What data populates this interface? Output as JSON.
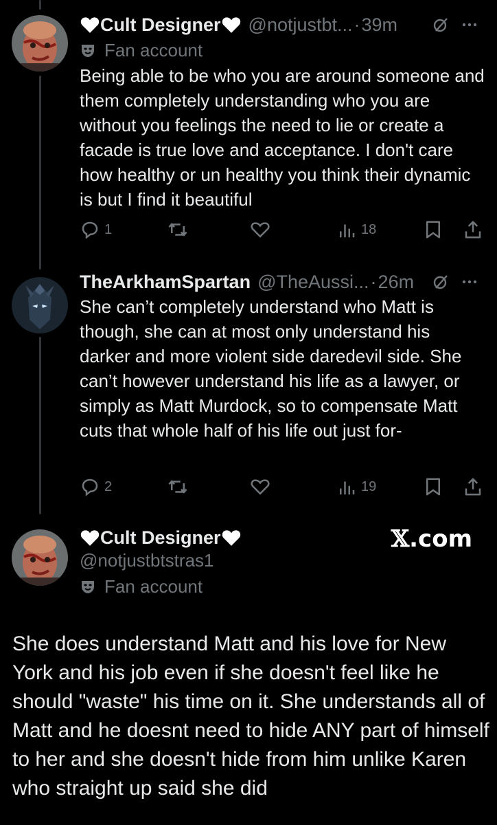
{
  "tweets": [
    {
      "display_name": "Cult Designer",
      "handle": "@notjustbt...",
      "time": "39m",
      "label": "Fan account",
      "text": "Being able to be who you are around someone and them completely understanding who you are without you feelings the need to lie or create a facade is true love and acceptance. I don't care how healthy or un healthy you think their dynamic is but I find it beautiful",
      "stats": {
        "replies": "1",
        "views": "18"
      }
    },
    {
      "display_name": "TheArkhamSpartan",
      "handle": "@TheAussi...",
      "time": "26m",
      "text": "She can’t completely understand who Matt is though, she can at most only understand his darker and more violent side daredevil side. She can’t however understand his life as a lawyer, or simply as Matt Murdock, so to compensate Matt cuts that whole half of his life out just for-",
      "stats": {
        "replies": "2",
        "views": "19"
      }
    }
  ],
  "reply": {
    "display_name": "Cult Designer",
    "handle": "@notjustbtstras1",
    "label": "Fan account",
    "text": "She does understand Matt and his love for New York and his job even if she doesn't feel like he should \"waste\" his time on it. She understands all of Matt and he doesnt need to hide ANY part of himself to her and she doesn't hide from him unlike Karen who straight up said she did"
  },
  "watermark": {
    "x": "𝕏",
    "domain": ".com"
  },
  "meta": {
    "dot": "·"
  },
  "colors": {
    "background": "#000000",
    "text": "#e7e9ea",
    "secondary": "#71767b",
    "thread_line": "#333639"
  },
  "icons": [
    "heart-icon",
    "fan-mask-icon",
    "grok-icon",
    "more-icon",
    "reply-icon",
    "retweet-icon",
    "like-icon",
    "views-icon",
    "bookmark-icon",
    "share-icon"
  ]
}
